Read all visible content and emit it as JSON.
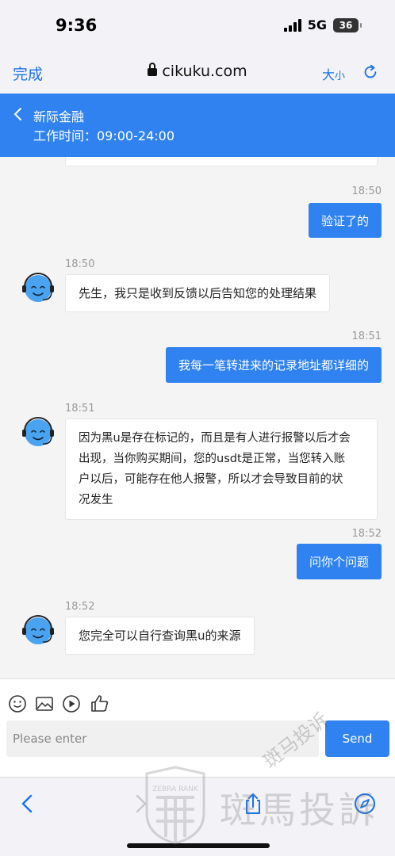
{
  "status_bar": {
    "time": "9:36",
    "network": "5G",
    "battery": "36"
  },
  "browser": {
    "done_label": "完成",
    "url": "cikuku.com",
    "text_size_label_big": "大",
    "text_size_label_small": "小"
  },
  "chat_header": {
    "title": "新际金融",
    "hours": "工作时间：09:00-24:00"
  },
  "messages": [
    {
      "from": "user",
      "time": "18:50",
      "text": "验证了的"
    },
    {
      "from": "agent",
      "time": "18:50",
      "text": "先生，我只是收到反馈以后告知您的处理结果"
    },
    {
      "from": "user",
      "time": "18:51",
      "text": "我每一笔转进来的记录地址都详细的"
    },
    {
      "from": "agent",
      "time": "18:51",
      "lines": [
        "因为黑u是存在标记的，而且是有人进行报警以后才会",
        "出现，当你购买期间，您的usdt是正常，当您转入账",
        "户以后，可能存在他人报警，所以才会导致目前的状",
        "况发生"
      ]
    },
    {
      "from": "user",
      "time": "18:52",
      "text": "问你个问题"
    },
    {
      "from": "agent",
      "time": "18:52",
      "text": "您完全可以自行查询黑u的来源"
    }
  ],
  "input": {
    "placeholder": "Please enter",
    "send_label": "Send"
  },
  "watermark": {
    "text": "斑馬投訴",
    "text_rotated": "斑马投诉",
    "badge": "ZEBRA RANK"
  },
  "colors": {
    "accent": "#2f82f0",
    "link": "#1b73e8"
  }
}
